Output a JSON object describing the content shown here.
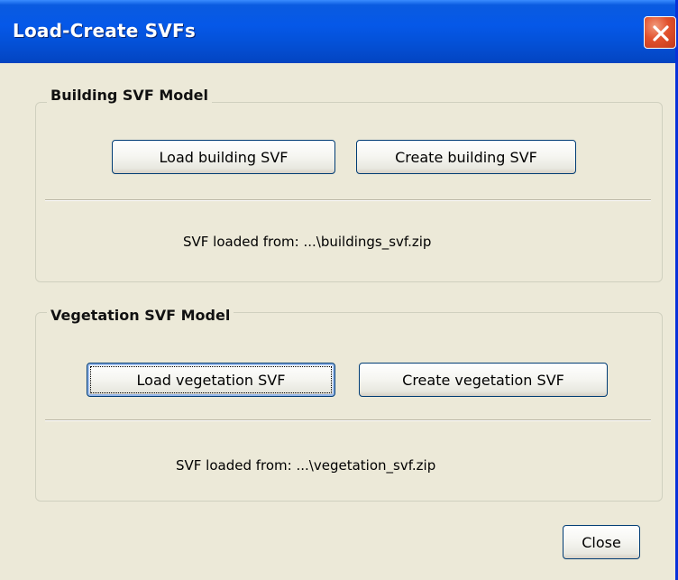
{
  "window": {
    "title": "Load-Create SVFs"
  },
  "building": {
    "group_title": "Building SVF Model",
    "load_button": "Load building SVF",
    "create_button": "Create building SVF",
    "status": "SVF loaded from: ...\\buildings_svf.zip"
  },
  "vegetation": {
    "group_title": "Vegetation SVF Model",
    "load_button": "Load vegetation SVF",
    "create_button": "Create vegetation SVF",
    "status": "SVF loaded from: ...\\vegetation_svf.zip"
  },
  "footer": {
    "close_button": "Close"
  },
  "icons": {
    "close": "close-icon"
  },
  "colors": {
    "titlebar": "#0558e8",
    "close_button": "#e2512c",
    "dialog_background": "#ece9d8"
  }
}
